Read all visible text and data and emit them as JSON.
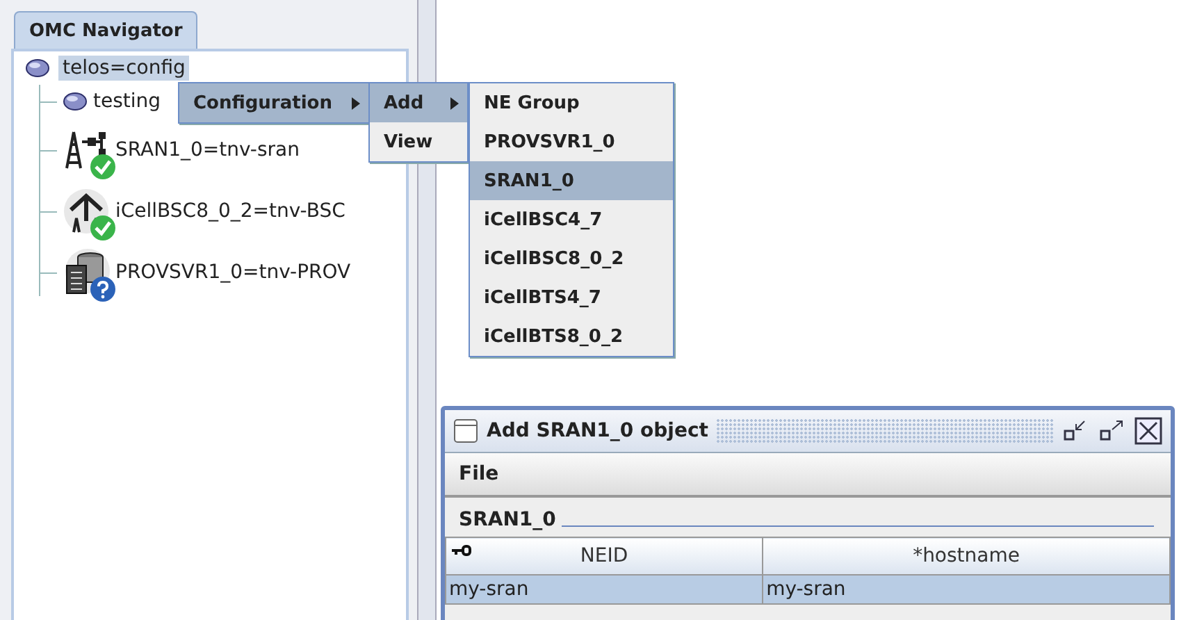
{
  "navigator": {
    "tab": {
      "label": "OMC Navigator",
      "selected": true
    },
    "tree": {
      "label": "telos=config",
      "kind": "globe",
      "selected": true,
      "children": [
        {
          "label": "testing",
          "kind": "globe",
          "selected": false
        },
        {
          "label": "SRAN1_0=tnv-sran",
          "kind": "tower",
          "verified": true,
          "selected": false
        },
        {
          "label": "iCellBSC8_0_2=tnv-BSC",
          "kind": "antenna",
          "verified": true,
          "selected": false
        },
        {
          "label": "PROVSVR1_0=tnv-PROV",
          "kind": "server",
          "verified": false,
          "selected": false
        }
      ]
    }
  },
  "context_menu": {
    "items": [
      {
        "label": "Configuration",
        "submenu": true,
        "selected": true
      }
    ]
  },
  "submenu": {
    "items": [
      {
        "label": "Add",
        "submenu": true,
        "selected": true
      },
      {
        "label": "View",
        "submenu": false,
        "selected": false
      }
    ]
  },
  "add_menu": {
    "items": [
      {
        "label": "NE Group",
        "selected": false
      },
      {
        "label": "PROVSVR1_0",
        "selected": false
      },
      {
        "label": "SRAN1_0",
        "selected": true
      },
      {
        "label": "iCellBSC4_7",
        "selected": false
      },
      {
        "label": "iCellBSC8_0_2",
        "selected": false
      },
      {
        "label": "iCellBTS4_7",
        "selected": false
      },
      {
        "label": "iCellBTS8_0_2",
        "selected": false
      }
    ]
  },
  "dialog": {
    "title": "Add SRAN1_0 object",
    "menu": [
      "File"
    ],
    "section": "SRAN1_0",
    "table": {
      "columns": [
        {
          "label": "NEID",
          "key": true
        },
        {
          "label": "*hostname",
          "key": false
        }
      ],
      "rows": [
        {
          "cells": [
            "my-sran",
            "my-sran"
          ],
          "selected": true
        }
      ]
    }
  }
}
